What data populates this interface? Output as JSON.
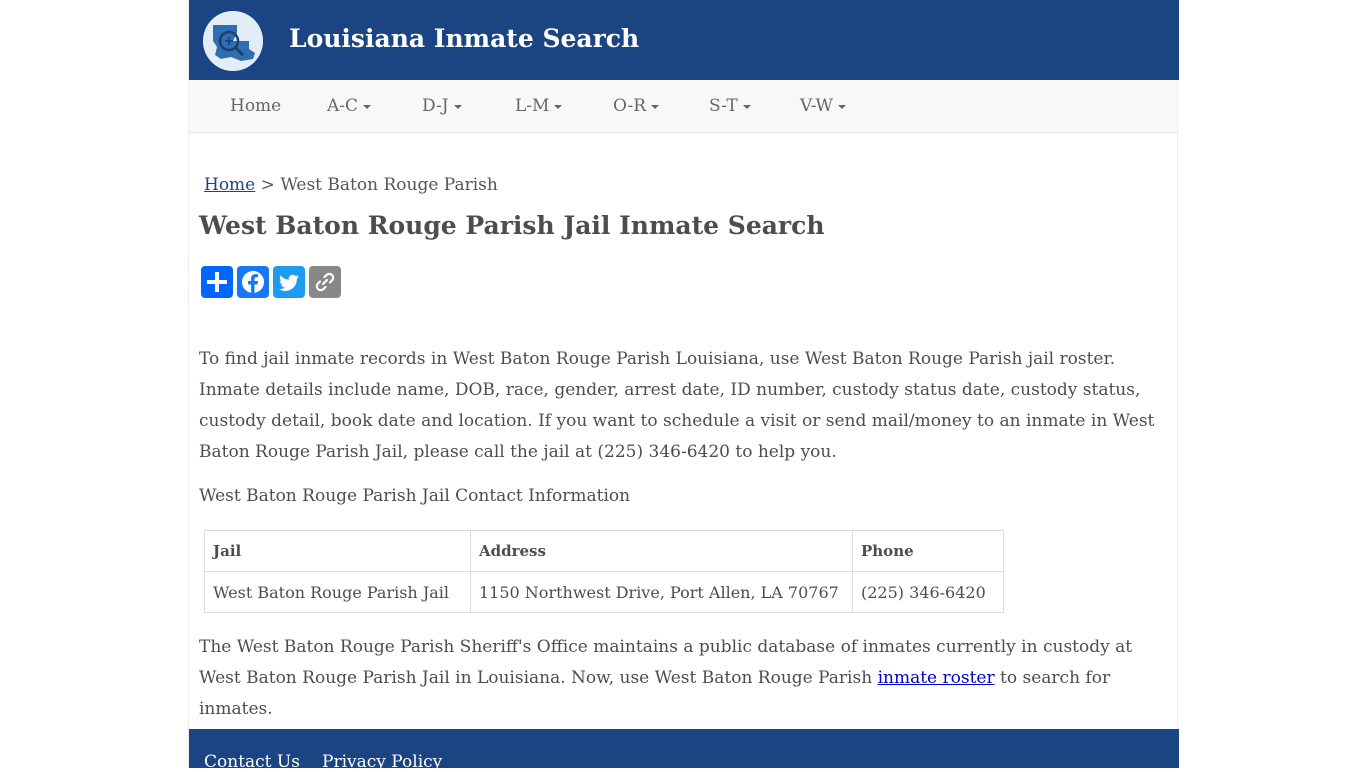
{
  "site": {
    "title": "Louisiana Inmate Search",
    "colors": {
      "header_bg": "#1b4582",
      "nav_bg": "#f8f8f8",
      "link": "#0000cc"
    }
  },
  "nav": {
    "items": [
      {
        "label": "Home",
        "dropdown": false
      },
      {
        "label": "A-C",
        "dropdown": true
      },
      {
        "label": "D-J",
        "dropdown": true
      },
      {
        "label": "L-M",
        "dropdown": true
      },
      {
        "label": "O-R",
        "dropdown": true
      },
      {
        "label": "S-T",
        "dropdown": true
      },
      {
        "label": "V-W",
        "dropdown": true
      }
    ]
  },
  "breadcrumb": {
    "home": "Home",
    "separator": ">",
    "current": "West Baton Rouge Parish"
  },
  "page": {
    "title": "West Baton Rouge Parish Jail Inmate Search",
    "intro": "To find jail inmate records in West Baton Rouge Parish Louisiana, use West Baton Rouge Parish jail roster. Inmate details include name, DOB, race, gender, arrest date, ID number, custody status date, custody status, custody detail, book date and location. If you want to schedule a visit or send mail/money to an inmate in West Baton Rouge Parish Jail, please call the jail at (225) 346-6420 to help you.",
    "contact_heading": "West Baton Rouge Parish Jail Contact Information",
    "closing_before": "The West Baton Rouge Parish Sheriff's Office maintains a public database of inmates currently in custody at West Baton Rouge Parish Jail in Louisiana. Now, use West Baton Rouge Parish ",
    "closing_link": "inmate roster",
    "closing_after": " to search for inmates."
  },
  "share": {
    "buttons": [
      {
        "icon": "share-plus-icon",
        "color": "#0166ff"
      },
      {
        "icon": "facebook-icon",
        "color": "#1877f2"
      },
      {
        "icon": "twitter-icon",
        "color": "#1d9bf0"
      },
      {
        "icon": "copy-link-icon",
        "color": "#888888"
      }
    ]
  },
  "table": {
    "headers": [
      "Jail",
      "Address",
      "Phone"
    ],
    "rows": [
      [
        "West Baton Rouge Parish Jail",
        "1150 Northwest Drive, Port Allen, LA 70767",
        "(225) 346-6420"
      ]
    ]
  },
  "footer": {
    "links": [
      "Contact Us",
      "Privacy Policy"
    ]
  }
}
